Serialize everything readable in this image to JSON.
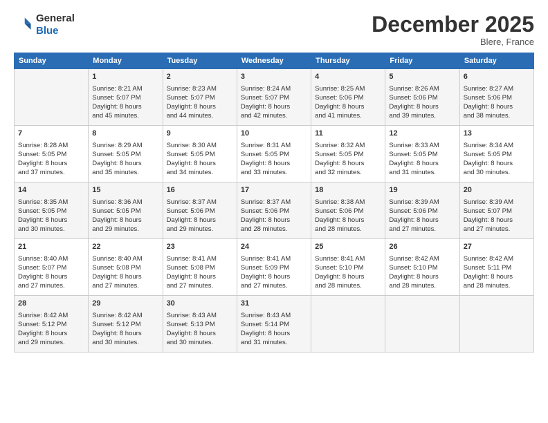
{
  "logo": {
    "line1": "General",
    "line2": "Blue"
  },
  "title": "December 2025",
  "location": "Blere, France",
  "days_of_week": [
    "Sunday",
    "Monday",
    "Tuesday",
    "Wednesday",
    "Thursday",
    "Friday",
    "Saturday"
  ],
  "weeks": [
    [
      {
        "day": "",
        "content": ""
      },
      {
        "day": "1",
        "content": "Sunrise: 8:21 AM\nSunset: 5:07 PM\nDaylight: 8 hours\nand 45 minutes."
      },
      {
        "day": "2",
        "content": "Sunrise: 8:23 AM\nSunset: 5:07 PM\nDaylight: 8 hours\nand 44 minutes."
      },
      {
        "day": "3",
        "content": "Sunrise: 8:24 AM\nSunset: 5:07 PM\nDaylight: 8 hours\nand 42 minutes."
      },
      {
        "day": "4",
        "content": "Sunrise: 8:25 AM\nSunset: 5:06 PM\nDaylight: 8 hours\nand 41 minutes."
      },
      {
        "day": "5",
        "content": "Sunrise: 8:26 AM\nSunset: 5:06 PM\nDaylight: 8 hours\nand 39 minutes."
      },
      {
        "day": "6",
        "content": "Sunrise: 8:27 AM\nSunset: 5:06 PM\nDaylight: 8 hours\nand 38 minutes."
      }
    ],
    [
      {
        "day": "7",
        "content": "Sunrise: 8:28 AM\nSunset: 5:05 PM\nDaylight: 8 hours\nand 37 minutes."
      },
      {
        "day": "8",
        "content": "Sunrise: 8:29 AM\nSunset: 5:05 PM\nDaylight: 8 hours\nand 35 minutes."
      },
      {
        "day": "9",
        "content": "Sunrise: 8:30 AM\nSunset: 5:05 PM\nDaylight: 8 hours\nand 34 minutes."
      },
      {
        "day": "10",
        "content": "Sunrise: 8:31 AM\nSunset: 5:05 PM\nDaylight: 8 hours\nand 33 minutes."
      },
      {
        "day": "11",
        "content": "Sunrise: 8:32 AM\nSunset: 5:05 PM\nDaylight: 8 hours\nand 32 minutes."
      },
      {
        "day": "12",
        "content": "Sunrise: 8:33 AM\nSunset: 5:05 PM\nDaylight: 8 hours\nand 31 minutes."
      },
      {
        "day": "13",
        "content": "Sunrise: 8:34 AM\nSunset: 5:05 PM\nDaylight: 8 hours\nand 30 minutes."
      }
    ],
    [
      {
        "day": "14",
        "content": "Sunrise: 8:35 AM\nSunset: 5:05 PM\nDaylight: 8 hours\nand 30 minutes."
      },
      {
        "day": "15",
        "content": "Sunrise: 8:36 AM\nSunset: 5:05 PM\nDaylight: 8 hours\nand 29 minutes."
      },
      {
        "day": "16",
        "content": "Sunrise: 8:37 AM\nSunset: 5:06 PM\nDaylight: 8 hours\nand 29 minutes."
      },
      {
        "day": "17",
        "content": "Sunrise: 8:37 AM\nSunset: 5:06 PM\nDaylight: 8 hours\nand 28 minutes."
      },
      {
        "day": "18",
        "content": "Sunrise: 8:38 AM\nSunset: 5:06 PM\nDaylight: 8 hours\nand 28 minutes."
      },
      {
        "day": "19",
        "content": "Sunrise: 8:39 AM\nSunset: 5:06 PM\nDaylight: 8 hours\nand 27 minutes."
      },
      {
        "day": "20",
        "content": "Sunrise: 8:39 AM\nSunset: 5:07 PM\nDaylight: 8 hours\nand 27 minutes."
      }
    ],
    [
      {
        "day": "21",
        "content": "Sunrise: 8:40 AM\nSunset: 5:07 PM\nDaylight: 8 hours\nand 27 minutes."
      },
      {
        "day": "22",
        "content": "Sunrise: 8:40 AM\nSunset: 5:08 PM\nDaylight: 8 hours\nand 27 minutes."
      },
      {
        "day": "23",
        "content": "Sunrise: 8:41 AM\nSunset: 5:08 PM\nDaylight: 8 hours\nand 27 minutes."
      },
      {
        "day": "24",
        "content": "Sunrise: 8:41 AM\nSunset: 5:09 PM\nDaylight: 8 hours\nand 27 minutes."
      },
      {
        "day": "25",
        "content": "Sunrise: 8:41 AM\nSunset: 5:10 PM\nDaylight: 8 hours\nand 28 minutes."
      },
      {
        "day": "26",
        "content": "Sunrise: 8:42 AM\nSunset: 5:10 PM\nDaylight: 8 hours\nand 28 minutes."
      },
      {
        "day": "27",
        "content": "Sunrise: 8:42 AM\nSunset: 5:11 PM\nDaylight: 8 hours\nand 28 minutes."
      }
    ],
    [
      {
        "day": "28",
        "content": "Sunrise: 8:42 AM\nSunset: 5:12 PM\nDaylight: 8 hours\nand 29 minutes."
      },
      {
        "day": "29",
        "content": "Sunrise: 8:42 AM\nSunset: 5:12 PM\nDaylight: 8 hours\nand 30 minutes."
      },
      {
        "day": "30",
        "content": "Sunrise: 8:43 AM\nSunset: 5:13 PM\nDaylight: 8 hours\nand 30 minutes."
      },
      {
        "day": "31",
        "content": "Sunrise: 8:43 AM\nSunset: 5:14 PM\nDaylight: 8 hours\nand 31 minutes."
      },
      {
        "day": "",
        "content": ""
      },
      {
        "day": "",
        "content": ""
      },
      {
        "day": "",
        "content": ""
      }
    ]
  ]
}
